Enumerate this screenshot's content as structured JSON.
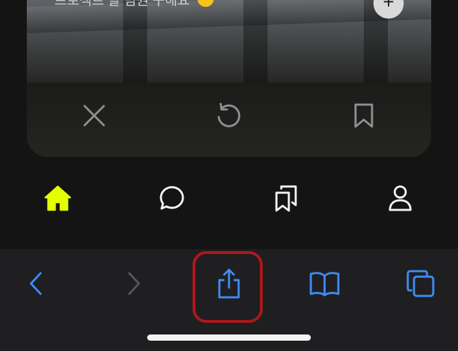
{
  "card": {
    "title": "프로젝트 할 팀원 구해요",
    "title_emoji": "sunglasses-emoji",
    "plus_label": "+",
    "actions": [
      {
        "icon": "close-icon"
      },
      {
        "icon": "undo-icon"
      },
      {
        "icon": "bookmark-icon"
      }
    ]
  },
  "app_nav": {
    "items": [
      {
        "icon": "home-icon",
        "active": true
      },
      {
        "icon": "chat-icon",
        "active": false
      },
      {
        "icon": "bookmarks-icon",
        "active": false
      },
      {
        "icon": "profile-icon",
        "active": false
      }
    ],
    "active_color": "#e4ff00",
    "inactive_color": "#f4f4f4"
  },
  "safari_toolbar": {
    "buttons": [
      {
        "icon": "back-icon",
        "enabled": true
      },
      {
        "icon": "forward-icon",
        "enabled": false
      },
      {
        "icon": "share-icon",
        "enabled": true,
        "highlighted": true
      },
      {
        "icon": "book-icon",
        "enabled": true
      },
      {
        "icon": "tabs-icon",
        "enabled": true
      }
    ],
    "accent_color": "#3f8df5",
    "disabled_color": "#57585c",
    "highlight_color": "#b2171a"
  }
}
